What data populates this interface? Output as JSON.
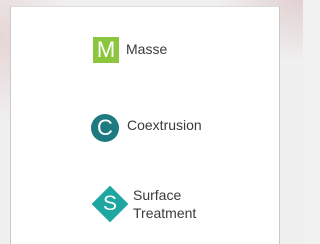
{
  "legend": {
    "items": [
      {
        "key": "masse",
        "glyph": "M",
        "label": "Masse",
        "color": "#8cc63f",
        "shape": "square",
        "icon": "m-square-icon"
      },
      {
        "key": "coextrusion",
        "glyph": "C",
        "label": "Coextrusion",
        "color": "#1c7a80",
        "shape": "circle",
        "icon": "c-circle-icon"
      },
      {
        "key": "surface",
        "glyph": "S",
        "label": "Surface Treatment",
        "color": "#1ea7a0",
        "shape": "diamond",
        "icon": "s-diamond-icon"
      }
    ]
  }
}
